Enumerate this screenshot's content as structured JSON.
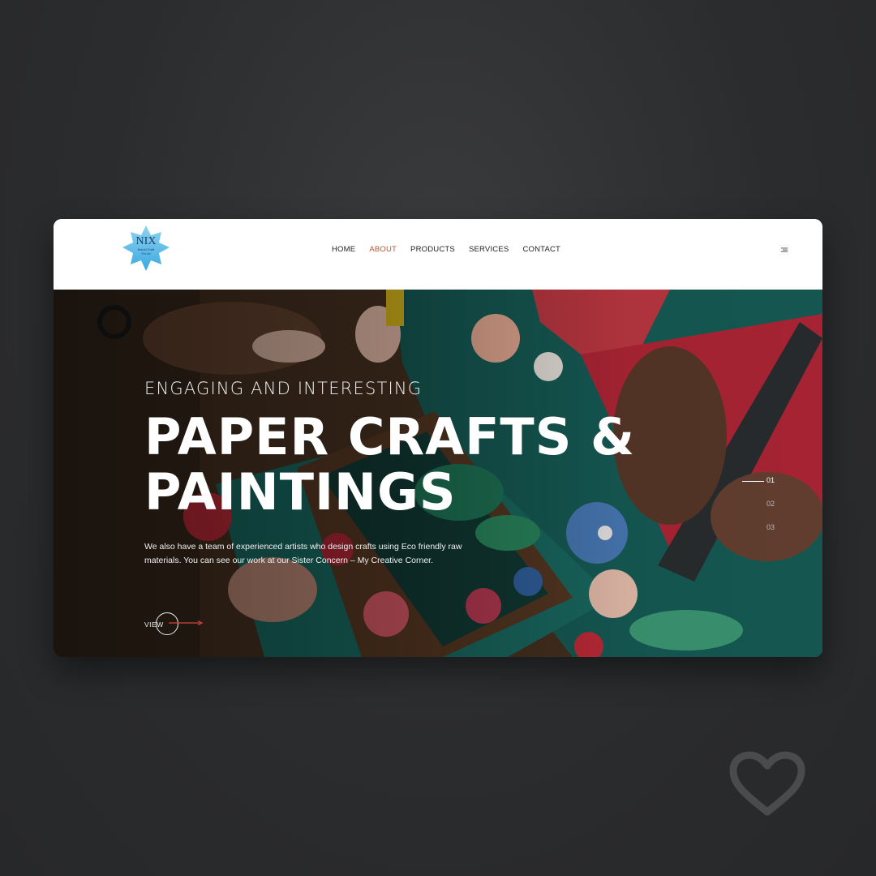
{
  "brand": {
    "logo_text": "NIX",
    "logo_subtext": "Mould Craft",
    "logo_subtext2": "Pvt Ltd"
  },
  "nav": {
    "items": [
      {
        "label": "HOME",
        "active": false
      },
      {
        "label": "ABOUT",
        "active": true
      },
      {
        "label": "PRODUCTS",
        "active": false
      },
      {
        "label": "SERVICES",
        "active": false
      },
      {
        "label": "CONTACT",
        "active": false
      }
    ],
    "menu_icon": "hamburger-menu-icon"
  },
  "hero": {
    "kicker": "ENGAGING AND INTERESTING",
    "headline_line1": "PAPER CRAFTS &",
    "headline_line2": "PAINTINGS",
    "description": "We also have a team of experienced artists who design crafts using Eco friendly raw materials. You can see our work at our Sister Concern – My Creative Corner.",
    "cta_label": "VIEW",
    "slides": [
      {
        "label": "01",
        "active": true
      },
      {
        "label": "02",
        "active": false
      },
      {
        "label": "03",
        "active": false
      }
    ]
  },
  "colors": {
    "accent": "#b5532f",
    "page_background": "#2b2c2e"
  },
  "decorations": {
    "heart_icon": "heart-outline-icon"
  }
}
